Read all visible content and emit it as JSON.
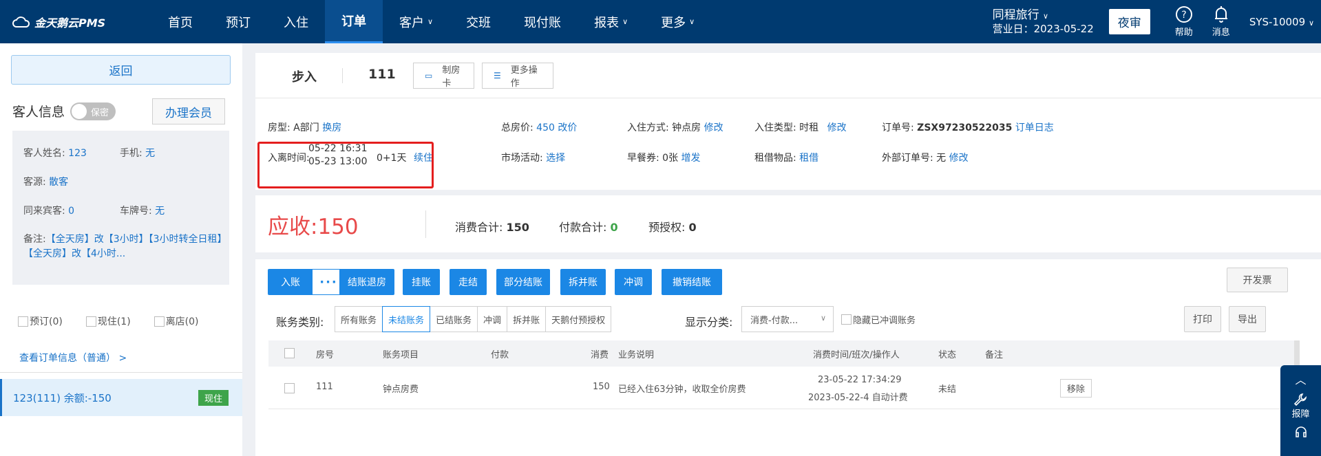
{
  "topbar": {
    "logo": "金天鹅云PMS",
    "nav": [
      {
        "label": "首页",
        "chev": false
      },
      {
        "label": "预订",
        "chev": false
      },
      {
        "label": "入住",
        "chev": false
      },
      {
        "label": "订单",
        "chev": false,
        "active": true
      },
      {
        "label": "客户",
        "chev": true
      },
      {
        "label": "交班",
        "chev": false
      },
      {
        "label": "现付账",
        "chev": false
      },
      {
        "label": "报表",
        "chev": true
      },
      {
        "label": "更多",
        "chev": true
      }
    ],
    "hotel_name": "同程旅行",
    "business_date": "营业日：2023-05-22",
    "night_audit": "夜审",
    "help": "帮助",
    "message": "消息",
    "user": "SYS-10009"
  },
  "left": {
    "back": "返回",
    "guest_info": "客人信息",
    "secret_toggle": "保密",
    "member_btn": "办理会员",
    "guest_name_label": "客人姓名:",
    "guest_name": "123",
    "phone_label": "手机:",
    "phone": "无",
    "source_label": "客源:",
    "source": "散客",
    "companion_label": "同来宾客:",
    "companion": "0",
    "plate_label": "车牌号:",
    "plate": "无",
    "remark_label": "备注:",
    "remark": "【全天房】改【3小时】【3小时转全日租】【全天房】改【4小时...",
    "filters": [
      "预订(0)",
      "现住(1)",
      "离店(0)"
    ],
    "view_order": "查看订单信息（普通） >",
    "room_entry": "123(111)  余额:-150",
    "room_status": "现住"
  },
  "order": {
    "type": "步入",
    "room": "111",
    "make_card": "制房卡",
    "more_ops": "更多操作",
    "room_type_label": "房型:",
    "room_type": "A部门",
    "change_room": "换房",
    "checkin_time_label": "入离时间:",
    "checkin_time": "05-22 16:31",
    "checkout_time": "05-23 13:00",
    "nights": "0+1天",
    "extend": "续住",
    "total_price_label": "总房价:",
    "total_price": "450",
    "change_price": "改价",
    "market_label": "市场活动:",
    "market": "选择",
    "checkin_mode_label": "入住方式:",
    "checkin_mode": "钟点房",
    "modify1": "修改",
    "breakfast_label": "早餐券:",
    "breakfast": "0张",
    "add_breakfast": "增发",
    "checkin_type_label": "入住类型:",
    "checkin_type": "时租",
    "modify2": "修改",
    "rent_label": "租借物品:",
    "rent": "租借",
    "order_no_label": "订单号:",
    "order_no": "ZSX97230522035",
    "order_log": "订单日志",
    "ext_order_label": "外部订单号:",
    "ext_order": "无",
    "modify3": "修改"
  },
  "summary": {
    "due_label": "应收:",
    "due": "150",
    "consume_label": "消费合计:",
    "consume": "150",
    "pay_label": "付款合计:",
    "pay": "0",
    "preauth_label": "预授权:",
    "preauth": "0"
  },
  "account": {
    "post": "入账",
    "more": "···",
    "buttons": [
      "结账退房",
      "挂账",
      "走结",
      "部分结账",
      "拆并账",
      "冲调",
      "撤销结账"
    ],
    "invoice": "开发票",
    "print": "打印",
    "export": "导出",
    "category_label": "账务类别:",
    "categories": [
      "所有账务",
      "未结账务",
      "已结账务",
      "冲调",
      "拆并账",
      "天鹅付预授权"
    ],
    "active_category": 1,
    "display_label": "显示分类:",
    "display_value": "消费-付款...",
    "hide_adjusted": "隐藏已冲调账务",
    "columns": {
      "room": "房号",
      "item": "账务项目",
      "pay": "付款",
      "consume": "消费",
      "desc": "业务说明",
      "time": "消费时间/班次/操作人",
      "status": "状态",
      "remark": "备注"
    },
    "rows": [
      {
        "room": "111",
        "item": "钟点房费",
        "pay": "",
        "consume": "150",
        "desc": "已经入住63分钟，收取全价房费",
        "time": "23-05-22 17:34:29",
        "shift": "2023-05-22-4 自动计费",
        "status": "未结",
        "action": "移除"
      }
    ]
  },
  "float": {
    "report": "报障"
  }
}
